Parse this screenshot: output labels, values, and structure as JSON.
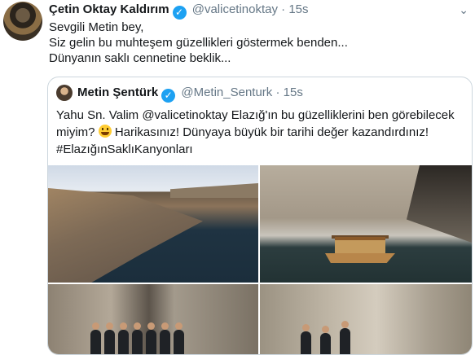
{
  "tweet": {
    "author_name": "Çetin Oktay Kaldırım",
    "handle": "@valicetinoktay",
    "separator": "·",
    "time": "15s",
    "lines": [
      "Sevgili Metin bey,",
      "Siz gelin bu muhteşem güzellikleri göstermek benden...",
      "Dünyanın saklı cennetine beklik..."
    ]
  },
  "quoted": {
    "author_name": "Metin Şentürk",
    "handle": "@Metin_Senturk",
    "separator": "·",
    "time": "15s",
    "line1": "Yahu Sn. Valim @valicetinoktay Elazığ'ın bu güzelliklerini ben görebilecek",
    "line2_start": "miyim?",
    "line2_end": "Harikasınız! Dünyaya büyük bir tarihi değer kazandırdınız!",
    "line3": "#ElazığınSaklıKanyonları"
  },
  "icons": {
    "verified": "verified-badge-icon",
    "menu": "chevron-down-icon",
    "emoji": "grinning-face-emoji"
  },
  "colors": {
    "accent": "#1da1f2",
    "secondary_text": "#657786",
    "border": "#ccd6dd"
  }
}
